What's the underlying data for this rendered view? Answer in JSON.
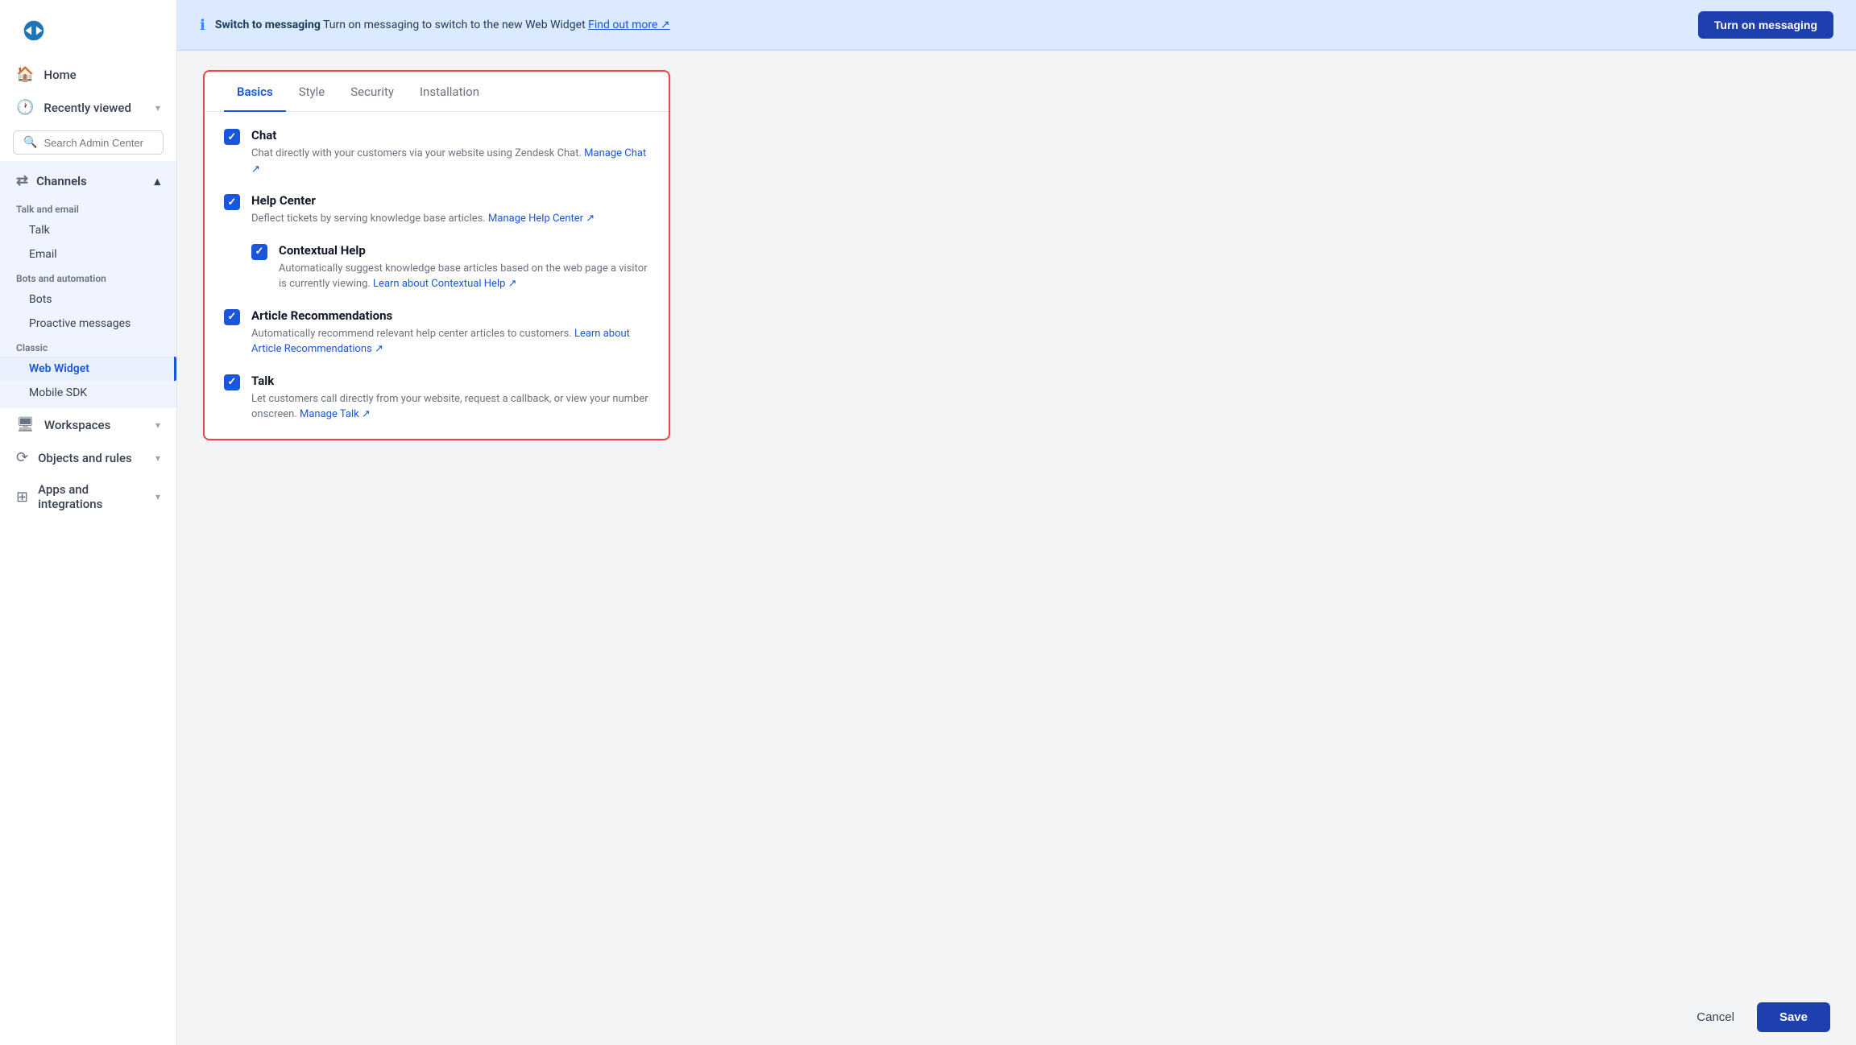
{
  "brand": {
    "logo_alt": "Zendesk"
  },
  "sidebar": {
    "home_label": "Home",
    "recently_viewed_label": "Recently viewed",
    "search_placeholder": "Search Admin Center",
    "channels_label": "Channels",
    "talk_email_label": "Talk and email",
    "talk_label": "Talk",
    "email_label": "Email",
    "bots_automation_label": "Bots and automation",
    "bots_label": "Bots",
    "proactive_messages_label": "Proactive messages",
    "classic_label": "Classic",
    "web_widget_label": "Web Widget",
    "mobile_sdk_label": "Mobile SDK",
    "workspaces_label": "Workspaces",
    "objects_rules_label": "Objects and rules",
    "apps_integrations_label": "Apps and integrations"
  },
  "banner": {
    "icon": "ℹ",
    "title": "Switch to messaging",
    "description": "Turn on messaging to switch to the new Web Widget",
    "link_text": "Find out more ↗",
    "button_label": "Turn on messaging"
  },
  "tabs": [
    {
      "id": "basics",
      "label": "Basics",
      "active": true
    },
    {
      "id": "style",
      "label": "Style",
      "active": false
    },
    {
      "id": "security",
      "label": "Security",
      "active": false
    },
    {
      "id": "installation",
      "label": "Installation",
      "active": false
    }
  ],
  "settings": [
    {
      "id": "chat",
      "title": "Chat",
      "description": "Chat directly with your customers via your website using Zendesk Chat.",
      "link_text": "Manage Chat ↗",
      "checked": true
    },
    {
      "id": "help-center",
      "title": "Help Center",
      "description": "Deflect tickets by serving knowledge base articles.",
      "link_text": "Manage Help Center ↗",
      "checked": true
    },
    {
      "id": "contextual-help",
      "title": "Contextual Help",
      "description": "Automatically suggest knowledge base articles based on the web page a visitor is currently viewing.",
      "link_text": "Learn about Contextual Help ↗",
      "checked": true,
      "indent": true
    },
    {
      "id": "article-recommendations",
      "title": "Article Recommendations",
      "description": "Automatically recommend relevant help center articles to customers.",
      "link_text": "Learn about Article Recommendations ↗",
      "checked": true
    },
    {
      "id": "talk",
      "title": "Talk",
      "description": "Let customers call directly from your website, request a callback, or view your number onscreen.",
      "link_text": "Manage Talk ↗",
      "checked": true
    }
  ],
  "footer": {
    "cancel_label": "Cancel",
    "save_label": "Save"
  }
}
